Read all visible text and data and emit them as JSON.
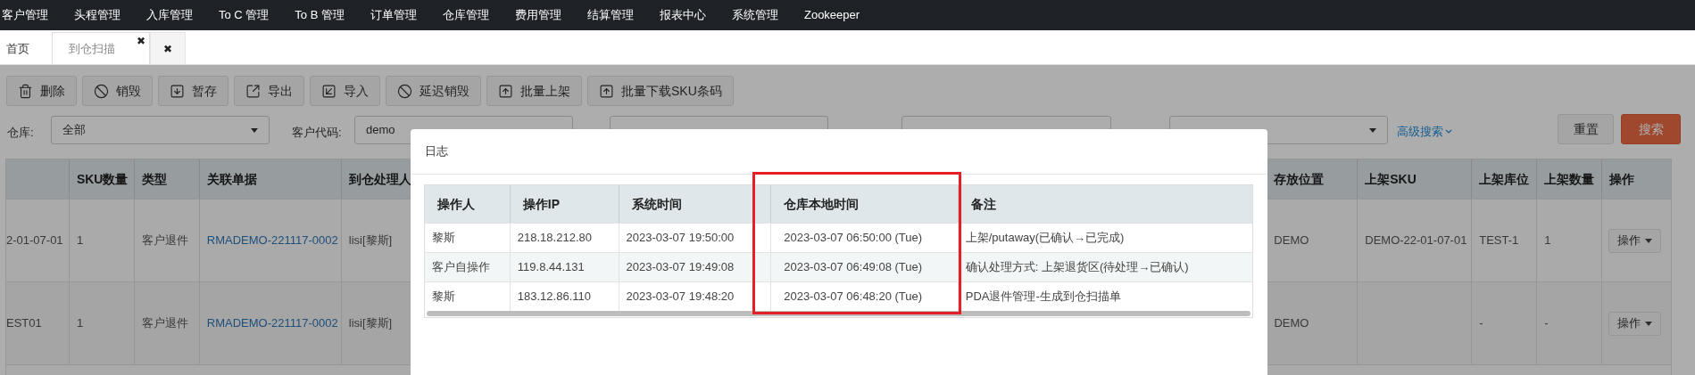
{
  "nav": [
    {
      "label": "客户管理"
    },
    {
      "label": "头程管理"
    },
    {
      "label": "入库管理"
    },
    {
      "label": "To C 管理"
    },
    {
      "label": "To B 管理"
    },
    {
      "label": "订单管理"
    },
    {
      "label": "仓库管理"
    },
    {
      "label": "费用管理"
    },
    {
      "label": "结算管理"
    },
    {
      "label": "报表中心"
    },
    {
      "label": "系统管理"
    },
    {
      "label": "Zookeeper"
    }
  ],
  "tabs": [
    {
      "label": "首页",
      "selected": false
    },
    {
      "label": "到仓扫描",
      "close": "✖",
      "selected": true
    },
    {
      "close": "✖",
      "selected": false
    }
  ],
  "toolbar": [
    {
      "label": "删除",
      "kind": "trash"
    },
    {
      "label": "销毁",
      "kind": "ban"
    },
    {
      "label": "暂存",
      "kind": "download"
    },
    {
      "label": "导出",
      "kind": "export"
    },
    {
      "label": "导入",
      "kind": "import"
    },
    {
      "label": "延迟销毁",
      "kind": "ban"
    },
    {
      "label": "批量上架",
      "kind": "upload"
    },
    {
      "label": "批量下载SKU条码",
      "kind": "upload"
    }
  ],
  "filters": {
    "warehouse": {
      "label": "仓库:",
      "value": "全部"
    },
    "customer": {
      "label": "客户代码:",
      "value": "demo"
    },
    "advanced": "高级搜索",
    "reset": "重置",
    "search": "搜索"
  },
  "table": {
    "left_columns": [
      "SKU数量",
      "类型",
      "关联单据",
      "到仓处理人"
    ],
    "right_columns": [
      "存放位置",
      "上架SKU",
      "上架库位",
      "上架数量",
      "操作"
    ],
    "rows": [
      {
        "column_1": "2-01-07-01",
        "sku_qty": "1",
        "type": "客户退件",
        "ref": "RMADEMO-221117-0002",
        "handler": "lisi[黎斯]",
        "location": "DEMO",
        "shelf_sku": "DEMO-22-01-07-01",
        "shelf_bin": "TEST-1",
        "shelf_qty": "1",
        "action": "操作"
      },
      {
        "column_1": "EST01",
        "sku_qty": "1",
        "type": "客户退件",
        "ref": "RMADEMO-221117-0002",
        "handler": "lisi[黎斯]",
        "location": "DEMO",
        "shelf_bin": "-",
        "shelf_qty": "-",
        "action": "操作"
      }
    ]
  },
  "modal": {
    "title": "日志",
    "columns": [
      {
        "label": "操作人",
        "highlighted": false
      },
      {
        "label": "操作IP",
        "highlighted": false
      },
      {
        "label": "系统时间",
        "highlighted": false
      },
      {
        "label": "仓库本地时间",
        "highlighted": true
      },
      {
        "label": "备注",
        "highlighted": false
      }
    ],
    "rows": [
      [
        "黎斯",
        "218.18.212.80",
        "2023-03-07 19:50:00",
        "2023-03-07 06:50:00 (Tue)",
        "上架/putaway(已确认→已完成)"
      ],
      [
        "客户自操作",
        "119.8.44.131",
        "2023-03-07 19:49:08",
        "2023-03-07 06:49:08 (Tue)",
        "确认处理方式: 上架退货区(待处理→已确认)"
      ],
      [
        "黎斯",
        "183.12.86.110",
        "2023-03-07 19:48:20",
        "2023-03-07 06:48:20 (Tue)",
        "PDA退件管理-生成到仓扫描单"
      ]
    ]
  }
}
